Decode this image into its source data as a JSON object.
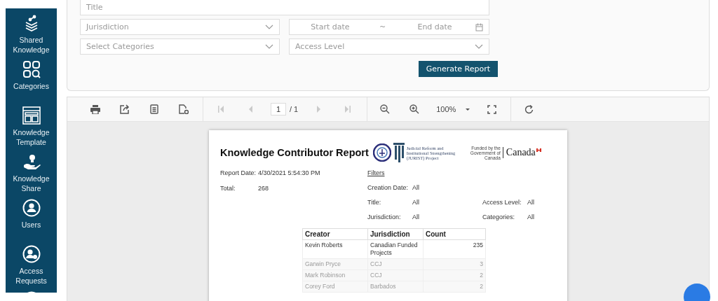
{
  "sidebar": {
    "items": [
      {
        "kind": "layers",
        "label": "Shared Knowledge"
      },
      {
        "kind": "categories",
        "label": "Categories"
      },
      {
        "kind": "template",
        "label": "Knowledge Template"
      },
      {
        "kind": "share",
        "label": "Knowledge Share"
      },
      {
        "kind": "user",
        "label": "Users"
      },
      {
        "kind": "access",
        "label": "Access Requests"
      },
      {
        "kind": "group"
      }
    ]
  },
  "filters": {
    "fields": [
      {
        "kind": "text",
        "placeholder": "Title"
      },
      {
        "kind": "select",
        "placeholder": "Jurisdiction"
      },
      {
        "kind": "daterange",
        "start_placeholder": "Start date",
        "separator": "~",
        "end_placeholder": "End date"
      },
      {
        "kind": "select",
        "placeholder": "Select Categories"
      },
      {
        "kind": "select",
        "placeholder": "Access Level"
      }
    ],
    "button": "Generate Report"
  },
  "toolbar": {
    "groups": [
      [
        {
          "kind": "print",
          "disabled": false
        },
        {
          "kind": "export",
          "disabled": false
        },
        {
          "kind": "document",
          "disabled": false
        },
        {
          "kind": "page-setup",
          "disabled": false
        }
      ],
      [
        {
          "kind": "first",
          "disabled": true
        },
        {
          "kind": "prev",
          "disabled": true
        },
        {
          "kind": "page",
          "value": "1",
          "total": "/ 1"
        },
        {
          "kind": "next",
          "disabled": true
        },
        {
          "kind": "last",
          "disabled": true
        }
      ],
      [
        {
          "kind": "zoom-out",
          "disabled": false
        },
        {
          "kind": "zoom-in",
          "disabled": false
        },
        {
          "kind": "zoom",
          "value": "100%"
        },
        {
          "kind": "fullscreen",
          "disabled": false
        }
      ],
      [
        {
          "kind": "refresh",
          "disabled": false
        }
      ]
    ]
  },
  "report": {
    "title": "Knowledge Contributor Report",
    "logo_text": "Judicial Reform and Institutional Strengthening (JURIST) Project",
    "funded_text": "Funded by the Government of Canada",
    "canada": "Canada",
    "info": [
      {
        "label": "Report Date:",
        "value": "4/30/2021 5:54:30 PM"
      },
      {
        "label": "Total:",
        "value": "268"
      }
    ],
    "filters_heading": "Filters",
    "filters": [
      [
        {
          "label": "Creation Date:",
          "value": "All"
        }
      ],
      [
        {
          "label": "Title:",
          "value": "All"
        },
        {
          "label": "Access Level:",
          "value": "All"
        }
      ],
      [
        {
          "label": "Jurisdiction:",
          "value": "All"
        },
        {
          "label": "Categories:",
          "value": "All"
        }
      ]
    ],
    "table": {
      "columns": [
        "Creator",
        "Jurisdiction",
        "Count"
      ],
      "rows": [
        {
          "cells": [
            "Kevin Roberts",
            "Canadian Funded Projects",
            "235"
          ],
          "dimmed": false
        },
        {
          "cells": [
            "Garwin Pryce",
            "CCJ",
            "3"
          ],
          "dimmed": true
        },
        {
          "cells": [
            "Mark Robinson",
            "CCJ",
            "2"
          ],
          "dimmed": true
        },
        {
          "cells": [
            "Corey Ford",
            "Barbados",
            "2"
          ],
          "dimmed": true
        }
      ]
    }
  }
}
